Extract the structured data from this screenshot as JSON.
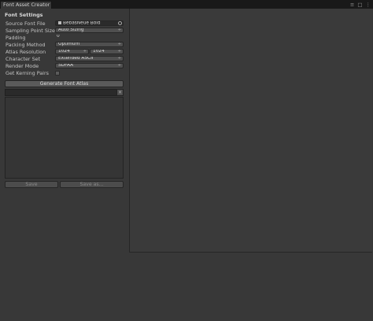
{
  "tab": {
    "title": "Font Asset Creator",
    "menu_glyph": "⋮",
    "close_glyph": "□",
    "maximize_glyph": "≡"
  },
  "settings": {
    "heading": "Font Settings",
    "source_font_label": "Source Font File",
    "source_font_value": "BebasNeue Bold",
    "sampling_label": "Sampling Point Size",
    "sampling_value": "Auto Sizing",
    "padding_label": "Padding",
    "padding_value": "0",
    "packing_label": "Packing Method",
    "packing_value": "Optimum",
    "atlas_label": "Atlas Resolution",
    "atlas_width": "1024",
    "atlas_height": "1024",
    "charset_label": "Character Set",
    "charset_value": "Extended ASCII",
    "render_label": "Render Mode",
    "render_value": "SDFAA",
    "kerning_label": "Get Kerning Pairs",
    "kerning_checked": false
  },
  "buttons": {
    "generate": "Generate Font Atlas",
    "save": "Save",
    "save_as": "Save as...",
    "clear": "×"
  },
  "icons": {
    "dropdown": "▾",
    "stepper": "÷"
  }
}
